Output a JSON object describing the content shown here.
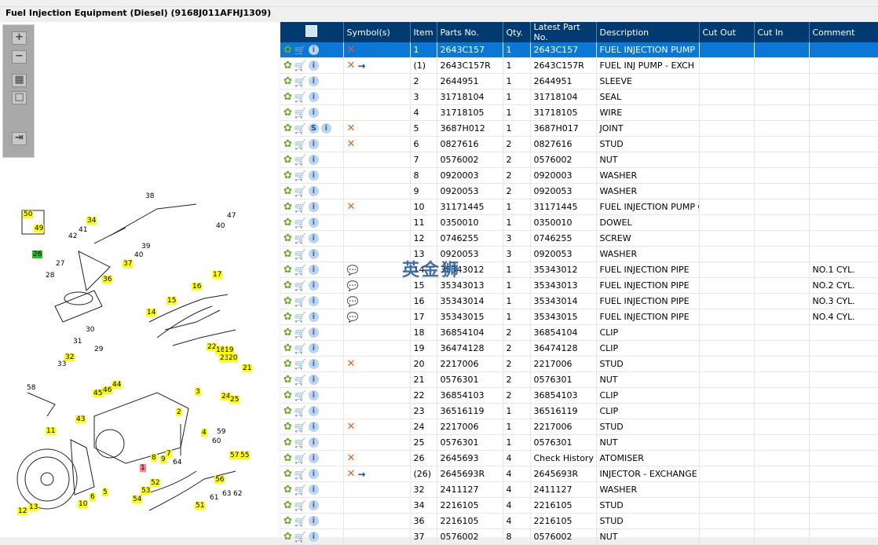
{
  "title": "Fuel Injection Equipment (Diesel) (9168J011AFHJ1309)",
  "toolbar": {
    "zoom_in": "+",
    "zoom_out": "−",
    "fit": "▦",
    "actual": "□",
    "export": "⇥"
  },
  "watermark": "英金狮",
  "columns": [
    "",
    "Symbol(s)",
    "Item",
    "Parts No.",
    "Qty.",
    "Latest Part No.",
    "Description",
    "Cut Out",
    "Cut In",
    "Comment"
  ],
  "rows": [
    {
      "s": "x",
      "item": "1",
      "part": "2643C157",
      "qty": "1",
      "latest": "2643C157",
      "desc": "FUEL INJECTION PUMP",
      "comment": ""
    },
    {
      "s": "xr",
      "item": "(1)",
      "part": "2643C157R",
      "qty": "1",
      "latest": "2643C157R",
      "desc": "FUEL INJ PUMP - EXCH",
      "comment": ""
    },
    {
      "s": "",
      "item": "2",
      "part": "2644951",
      "qty": "1",
      "latest": "2644951",
      "desc": "SLEEVE",
      "comment": ""
    },
    {
      "s": "",
      "item": "3",
      "part": "31718104",
      "qty": "1",
      "latest": "31718104",
      "desc": "SEAL",
      "comment": ""
    },
    {
      "s": "",
      "item": "4",
      "part": "31718105",
      "qty": "1",
      "latest": "31718105",
      "desc": "WIRE",
      "comment": ""
    },
    {
      "s": "x",
      "item": "5",
      "part": "3687H012",
      "qty": "1",
      "latest": "3687H017",
      "desc": "JOINT",
      "comment": ""
    },
    {
      "s": "x",
      "item": "6",
      "part": "0827616",
      "qty": "2",
      "latest": "0827616",
      "desc": "STUD",
      "comment": ""
    },
    {
      "s": "",
      "item": "7",
      "part": "0576002",
      "qty": "2",
      "latest": "0576002",
      "desc": "NUT",
      "comment": ""
    },
    {
      "s": "",
      "item": "8",
      "part": "0920003",
      "qty": "2",
      "latest": "0920003",
      "desc": "WASHER",
      "comment": ""
    },
    {
      "s": "",
      "item": "9",
      "part": "0920053",
      "qty": "2",
      "latest": "0920053",
      "desc": "WASHER",
      "comment": ""
    },
    {
      "s": "x",
      "item": "10",
      "part": "31171445",
      "qty": "1",
      "latest": "31171445",
      "desc": "FUEL INJECTION PUMP G",
      "comment": ""
    },
    {
      "s": "",
      "item": "11",
      "part": "0350010",
      "qty": "1",
      "latest": "0350010",
      "desc": "DOWEL",
      "comment": ""
    },
    {
      "s": "",
      "item": "12",
      "part": "0746255",
      "qty": "3",
      "latest": "0746255",
      "desc": "SCREW",
      "comment": ""
    },
    {
      "s": "",
      "item": "13",
      "part": "0920053",
      "qty": "3",
      "latest": "0920053",
      "desc": "WASHER",
      "comment": ""
    },
    {
      "s": "n",
      "item": "14",
      "part": "35343012",
      "qty": "1",
      "latest": "35343012",
      "desc": "FUEL INJECTION PIPE",
      "comment": "NO.1 CYL."
    },
    {
      "s": "n",
      "item": "15",
      "part": "35343013",
      "qty": "1",
      "latest": "35343013",
      "desc": "FUEL INJECTION PIPE",
      "comment": "NO.2 CYL."
    },
    {
      "s": "n",
      "item": "16",
      "part": "35343014",
      "qty": "1",
      "latest": "35343014",
      "desc": "FUEL INJECTION PIPE",
      "comment": "NO.3 CYL."
    },
    {
      "s": "n",
      "item": "17",
      "part": "35343015",
      "qty": "1",
      "latest": "35343015",
      "desc": "FUEL INJECTION PIPE",
      "comment": "NO.4 CYL."
    },
    {
      "s": "",
      "item": "18",
      "part": "36854104",
      "qty": "2",
      "latest": "36854104",
      "desc": "CLIP",
      "comment": ""
    },
    {
      "s": "",
      "item": "19",
      "part": "36474128",
      "qty": "2",
      "latest": "36474128",
      "desc": "CLIP",
      "comment": ""
    },
    {
      "s": "x",
      "item": "20",
      "part": "2217006",
      "qty": "2",
      "latest": "2217006",
      "desc": "STUD",
      "comment": ""
    },
    {
      "s": "",
      "item": "21",
      "part": "0576301",
      "qty": "2",
      "latest": "0576301",
      "desc": "NUT",
      "comment": ""
    },
    {
      "s": "",
      "item": "22",
      "part": "36854103",
      "qty": "2",
      "latest": "36854103",
      "desc": "CLIP",
      "comment": ""
    },
    {
      "s": "",
      "item": "23",
      "part": "36516119",
      "qty": "1",
      "latest": "36516119",
      "desc": "CLIP",
      "comment": ""
    },
    {
      "s": "x",
      "item": "24",
      "part": "2217006",
      "qty": "1",
      "latest": "2217006",
      "desc": "STUD",
      "comment": ""
    },
    {
      "s": "",
      "item": "25",
      "part": "0576301",
      "qty": "1",
      "latest": "0576301",
      "desc": "NUT",
      "comment": ""
    },
    {
      "s": "x",
      "item": "26",
      "part": "2645693",
      "qty": "4",
      "latest": "Check History",
      "desc": "ATOMISER",
      "comment": ""
    },
    {
      "s": "xr",
      "item": "(26)",
      "part": "2645693R",
      "qty": "4",
      "latest": "2645693R",
      "desc": "INJECTOR - EXCHANGE",
      "comment": ""
    },
    {
      "s": "",
      "item": "32",
      "part": "2411127",
      "qty": "4",
      "latest": "2411127",
      "desc": "WASHER",
      "comment": ""
    },
    {
      "s": "",
      "item": "34",
      "part": "2216105",
      "qty": "4",
      "latest": "2216105",
      "desc": "STUD",
      "comment": ""
    },
    {
      "s": "",
      "item": "36",
      "part": "2216105",
      "qty": "4",
      "latest": "2216105",
      "desc": "STUD",
      "comment": ""
    },
    {
      "s": "",
      "item": "37",
      "part": "0576002",
      "qty": "8",
      "latest": "0576002",
      "desc": "NUT",
      "comment": ""
    }
  ],
  "callouts": [
    "50",
    "49",
    "34",
    "38",
    "47",
    "40",
    "41",
    "42",
    "39",
    "37",
    "26",
    "36",
    "27",
    "28",
    "40",
    "17",
    "16",
    "15",
    "14",
    "30",
    "31",
    "29",
    "32",
    "33",
    "22",
    "18",
    "19",
    "23",
    "20",
    "21",
    "24",
    "25",
    "58",
    "45",
    "46",
    "44",
    "43",
    "3",
    "2",
    "11",
    "4",
    "59",
    "60",
    "57",
    "55",
    "56",
    "64",
    "7",
    "9",
    "8",
    "1",
    "6",
    "5",
    "52",
    "53",
    "54",
    "10",
    "12",
    "13",
    "51",
    "61",
    "63",
    "62"
  ]
}
